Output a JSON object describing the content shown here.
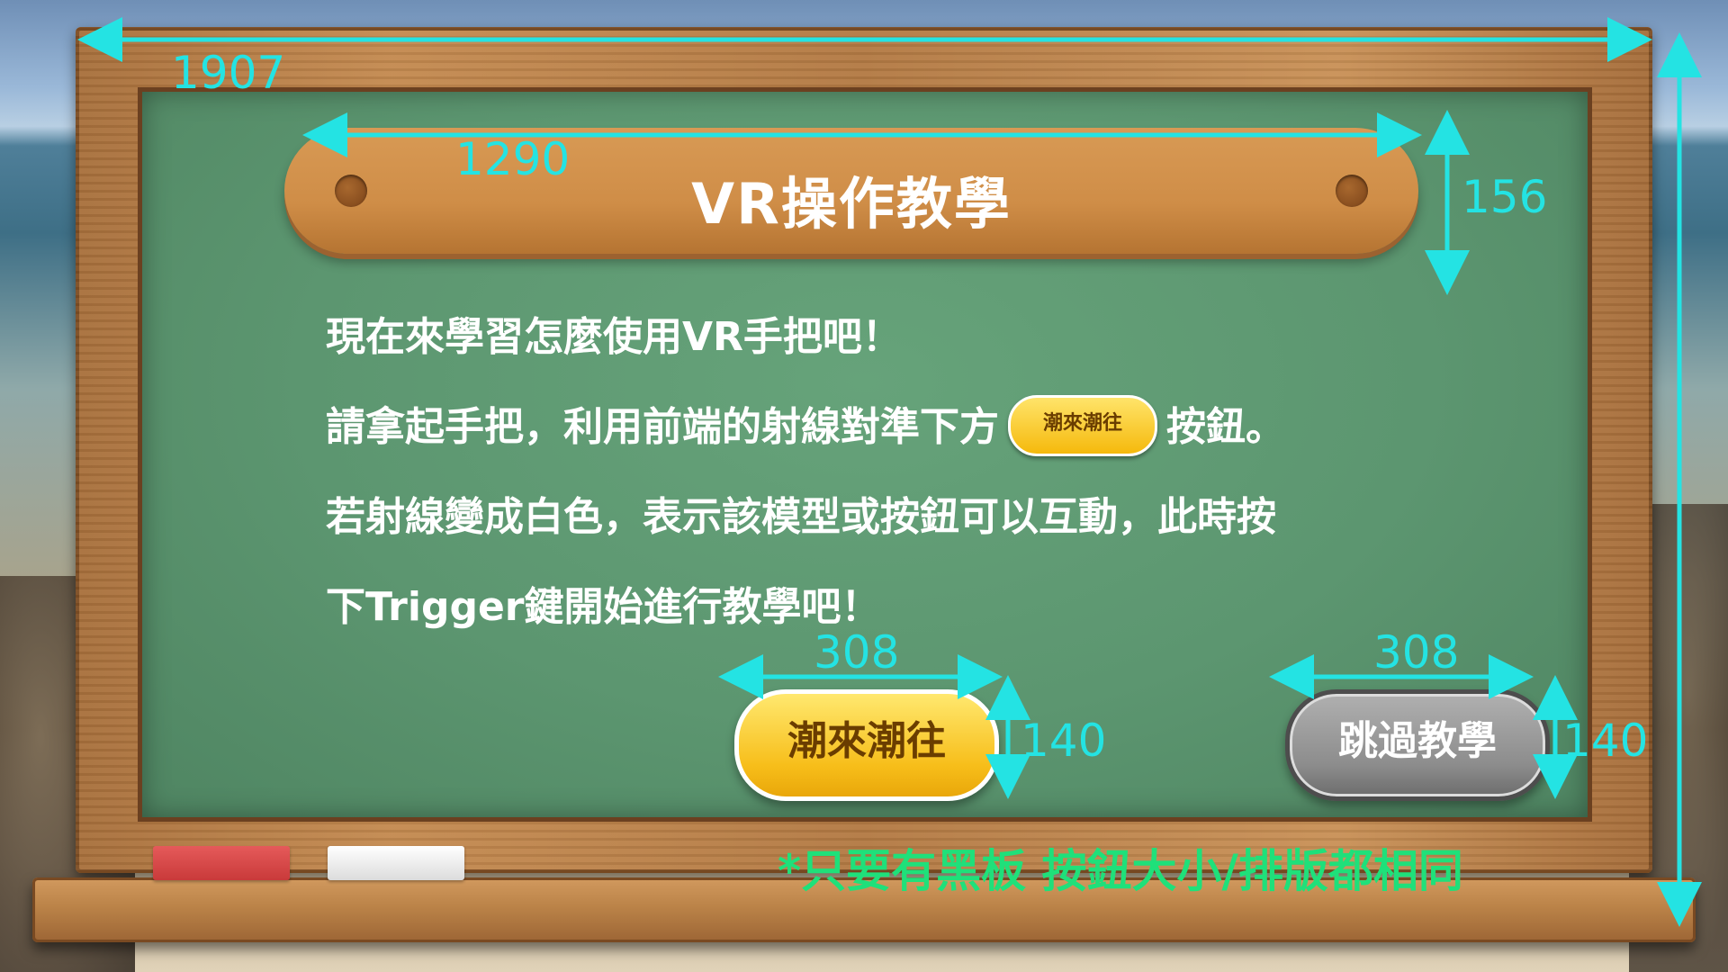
{
  "title": "VR操作教學",
  "instructions": {
    "line1": "現在來學習怎麼使用VR手把吧！",
    "line2_before": "請拿起手把，利用前端的射線對準下方",
    "line2_button": "潮來潮往",
    "line2_after": "按鈕。",
    "line3": "若射線變成白色，表示該模型或按鈕可以互動，此時按",
    "line4": "下Trigger鍵開始進行教學吧！"
  },
  "buttons": {
    "primary_label": "潮來潮往",
    "skip_label": "跳過教學"
  },
  "dimensions": {
    "board_width": "1907",
    "plank_width": "1290",
    "plank_height": "156",
    "primary_width": "308",
    "primary_height": "140",
    "skip_width": "308",
    "skip_height": "140"
  },
  "note": "*只要有黑板 按鈕大小/排版都相同",
  "colors": {
    "board": "#5c9670",
    "plank": "#cf8d47",
    "primary_button": "#f7be1a",
    "skip_button": "#8c8c8c",
    "dimension_lines": "#24e3e3",
    "note_text": "#1fe07a"
  }
}
